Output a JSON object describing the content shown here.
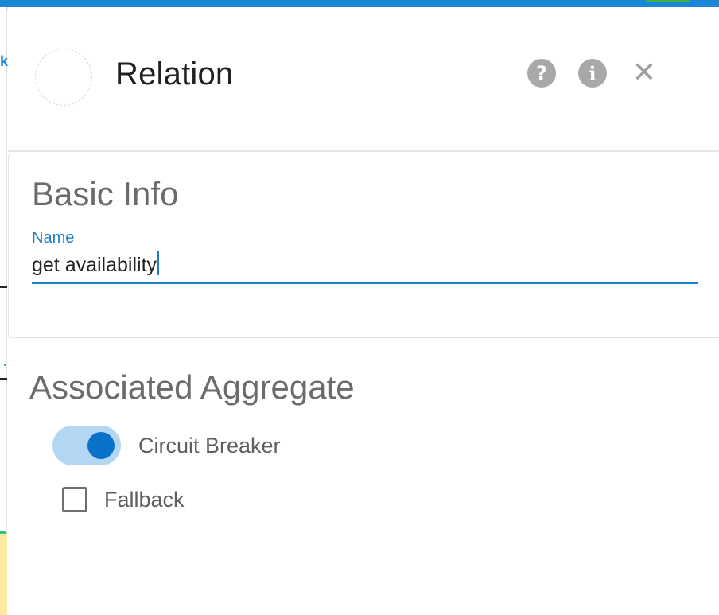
{
  "panel": {
    "title": "Relation",
    "header_icons": [
      "help-icon",
      "info-icon",
      "close-icon"
    ],
    "help_glyph": "?",
    "info_glyph": "i",
    "close_glyph": "✕"
  },
  "basic_info": {
    "heading": "Basic Info",
    "name_label": "Name",
    "name_value": "get availability"
  },
  "associated_aggregate": {
    "heading": "Associated Aggregate",
    "circuit_breaker_label": "Circuit Breaker",
    "circuit_breaker_on": true,
    "fallback_label": "Fallback",
    "fallback_checked": false
  },
  "background_page": {
    "fragment_text": "k"
  },
  "colors": {
    "accent": "#1a86d6",
    "toggle_track": "#b3d7f2",
    "toggle_thumb": "#0a72c9",
    "icon_grey": "#a8a8a8"
  }
}
